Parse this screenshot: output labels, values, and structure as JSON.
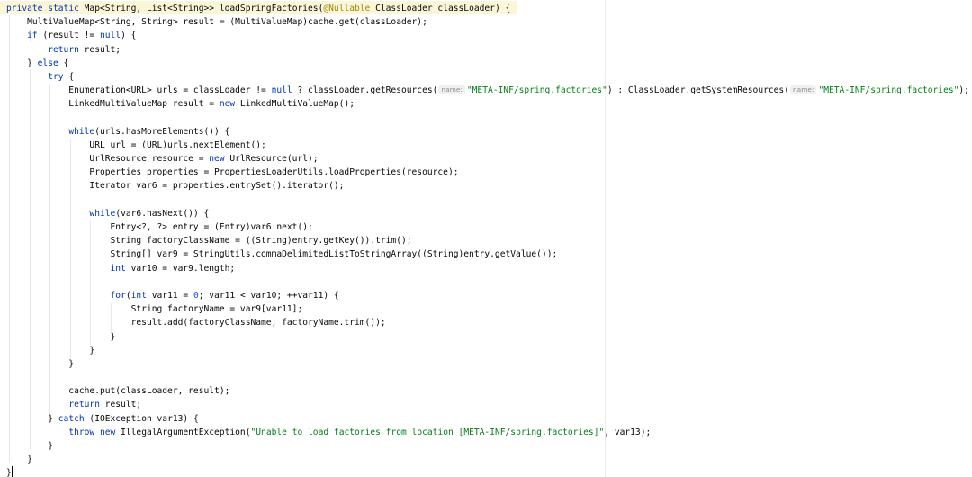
{
  "editor": {
    "lines": [
      [
        {
          "t": "kw",
          "v": "private"
        },
        {
          "t": "p",
          "v": " "
        },
        {
          "t": "kw",
          "v": "static"
        },
        {
          "t": "p",
          "v": " Map<String, List<String>> loadSpringFactories("
        },
        {
          "t": "anno",
          "v": "@Nullable"
        },
        {
          "t": "p",
          "v": " ClassLoader classLoader) {"
        }
      ],
      [
        {
          "t": "p",
          "v": "    MultiValueMap<String, String> result = (MultiValueMap)cache.get(classLoader);"
        }
      ],
      [
        {
          "t": "p",
          "v": "    "
        },
        {
          "t": "kw",
          "v": "if"
        },
        {
          "t": "p",
          "v": " (result != "
        },
        {
          "t": "kw",
          "v": "null"
        },
        {
          "t": "p",
          "v": ") {"
        }
      ],
      [
        {
          "t": "p",
          "v": "        "
        },
        {
          "t": "kw",
          "v": "return"
        },
        {
          "t": "p",
          "v": " result;"
        }
      ],
      [
        {
          "t": "p",
          "v": "    } "
        },
        {
          "t": "kw",
          "v": "else"
        },
        {
          "t": "p",
          "v": " {"
        }
      ],
      [
        {
          "t": "p",
          "v": "        "
        },
        {
          "t": "kw",
          "v": "try"
        },
        {
          "t": "p",
          "v": " {"
        }
      ],
      [
        {
          "t": "p",
          "v": "            Enumeration<URL> urls = classLoader != "
        },
        {
          "t": "kw",
          "v": "null"
        },
        {
          "t": "p",
          "v": " ? classLoader.getResources("
        },
        {
          "t": "hint",
          "v": "name:"
        },
        {
          "t": "str",
          "v": "\"META-INF/spring.factories\""
        },
        {
          "t": "p",
          "v": ") : ClassLoader.getSystemResources("
        },
        {
          "t": "hint",
          "v": "name:"
        },
        {
          "t": "str",
          "v": "\"META-INF/spring.factories\""
        },
        {
          "t": "p",
          "v": ");"
        }
      ],
      [
        {
          "t": "p",
          "v": "            LinkedMultiValueMap result = "
        },
        {
          "t": "kw",
          "v": "new"
        },
        {
          "t": "p",
          "v": " LinkedMultiValueMap();"
        }
      ],
      [],
      [
        {
          "t": "p",
          "v": "            "
        },
        {
          "t": "kw",
          "v": "while"
        },
        {
          "t": "p",
          "v": "(urls.hasMoreElements()) {"
        }
      ],
      [
        {
          "t": "p",
          "v": "                URL url = (URL)urls.nextElement();"
        }
      ],
      [
        {
          "t": "p",
          "v": "                UrlResource resource = "
        },
        {
          "t": "kw",
          "v": "new"
        },
        {
          "t": "p",
          "v": " UrlResource(url);"
        }
      ],
      [
        {
          "t": "p",
          "v": "                Properties properties = PropertiesLoaderUtils.loadProperties(resource);"
        }
      ],
      [
        {
          "t": "p",
          "v": "                Iterator var6 = properties.entrySet().iterator();"
        }
      ],
      [],
      [
        {
          "t": "p",
          "v": "                "
        },
        {
          "t": "kw",
          "v": "while"
        },
        {
          "t": "p",
          "v": "(var6.hasNext()) {"
        }
      ],
      [
        {
          "t": "p",
          "v": "                    Entry<?, ?> entry = (Entry)var6.next();"
        }
      ],
      [
        {
          "t": "p",
          "v": "                    String factoryClassName = ((String)entry.getKey()).trim();"
        }
      ],
      [
        {
          "t": "p",
          "v": "                    String[] var9 = StringUtils.commaDelimitedListToStringArray((String)entry.getValue());"
        }
      ],
      [
        {
          "t": "p",
          "v": "                    "
        },
        {
          "t": "kw",
          "v": "int"
        },
        {
          "t": "p",
          "v": " var10 = var9.length;"
        }
      ],
      [],
      [
        {
          "t": "p",
          "v": "                    "
        },
        {
          "t": "kw",
          "v": "for"
        },
        {
          "t": "p",
          "v": "("
        },
        {
          "t": "kw",
          "v": "int"
        },
        {
          "t": "p",
          "v": " var11 = "
        },
        {
          "t": "num",
          "v": "0"
        },
        {
          "t": "p",
          "v": "; var11 < var10; ++var11) {"
        }
      ],
      [
        {
          "t": "p",
          "v": "                        String factoryName = var9[var11];"
        }
      ],
      [
        {
          "t": "p",
          "v": "                        result.add(factoryClassName, factoryName.trim());"
        }
      ],
      [
        {
          "t": "p",
          "v": "                    }"
        }
      ],
      [
        {
          "t": "p",
          "v": "                }"
        }
      ],
      [
        {
          "t": "p",
          "v": "            }"
        }
      ],
      [],
      [
        {
          "t": "p",
          "v": "            cache.put(classLoader, result);"
        }
      ],
      [
        {
          "t": "p",
          "v": "            "
        },
        {
          "t": "kw",
          "v": "return"
        },
        {
          "t": "p",
          "v": " result;"
        }
      ],
      [
        {
          "t": "p",
          "v": "        } "
        },
        {
          "t": "kw",
          "v": "catch"
        },
        {
          "t": "p",
          "v": " (IOException var13) {"
        }
      ],
      [
        {
          "t": "p",
          "v": "            "
        },
        {
          "t": "kw",
          "v": "throw"
        },
        {
          "t": "p",
          "v": " "
        },
        {
          "t": "kw",
          "v": "new"
        },
        {
          "t": "p",
          "v": " IllegalArgumentException("
        },
        {
          "t": "str",
          "v": "\"Unable to load factories from location [META-INF/spring.factories]\""
        },
        {
          "t": "p",
          "v": ", var13);"
        }
      ],
      [
        {
          "t": "p",
          "v": "        }"
        }
      ],
      [
        {
          "t": "p",
          "v": "    }"
        }
      ],
      [
        {
          "t": "p",
          "v": "}"
        },
        {
          "t": "caret",
          "v": ""
        }
      ]
    ]
  }
}
